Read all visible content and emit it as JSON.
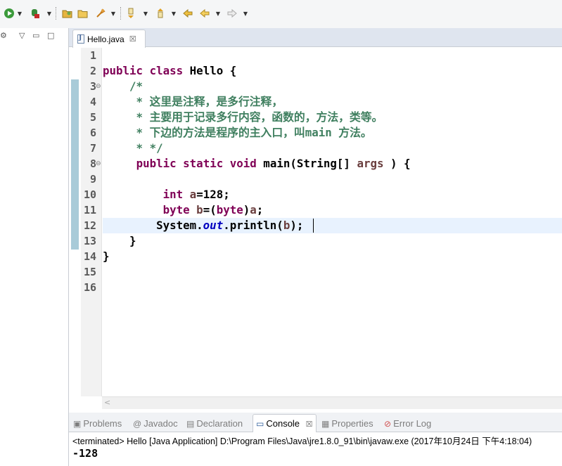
{
  "toolbar": {
    "items": [
      "run-icon",
      "debug-icon",
      "open-folder-icon",
      "open-file-icon",
      "pin-icon",
      "next-annotation-icon",
      "previous-annotation-icon",
      "last-edit-icon",
      "back-icon",
      "forward-icon"
    ]
  },
  "editor": {
    "tab": {
      "label": "Hello.java",
      "close": "☒"
    },
    "line_numbers": [
      "1",
      "2",
      "3",
      "4",
      "5",
      "6",
      "7",
      "8",
      "9",
      "10",
      "11",
      "12",
      "13",
      "14",
      "15",
      "16"
    ],
    "lines": [
      "",
      "public class Hello {",
      "    /*",
      "     * 这里是注释，是多行注释，",
      "     * 主要用于记录多行内容，函数的，方法，类等。",
      "     * 下边的方法是程序的主入口，叫main 方法。",
      "     * */",
      "     public static void main(String[] args ) {",
      "",
      "         int a=128;",
      "         byte b=(byte)a;",
      "        System.out.println(b);",
      "    }",
      "}",
      "",
      ""
    ],
    "current_line": 12
  },
  "panel": {
    "tabs": [
      {
        "label": "Problems",
        "icon": "problems-icon"
      },
      {
        "label": "Javadoc",
        "icon": "at-icon"
      },
      {
        "label": "Declaration",
        "icon": "declaration-icon"
      },
      {
        "label": "Console",
        "icon": "console-icon",
        "close": "☒",
        "active": true
      },
      {
        "label": "Properties",
        "icon": "properties-icon"
      },
      {
        "label": "Error Log",
        "icon": "error-log-icon"
      }
    ],
    "console_description": "<terminated> Hello [Java Application] D:\\Program Files\\Java\\jre1.8.0_91\\bin\\javaw.exe (2017年10月24日 下午4:18:04)",
    "console_output": "-128"
  }
}
